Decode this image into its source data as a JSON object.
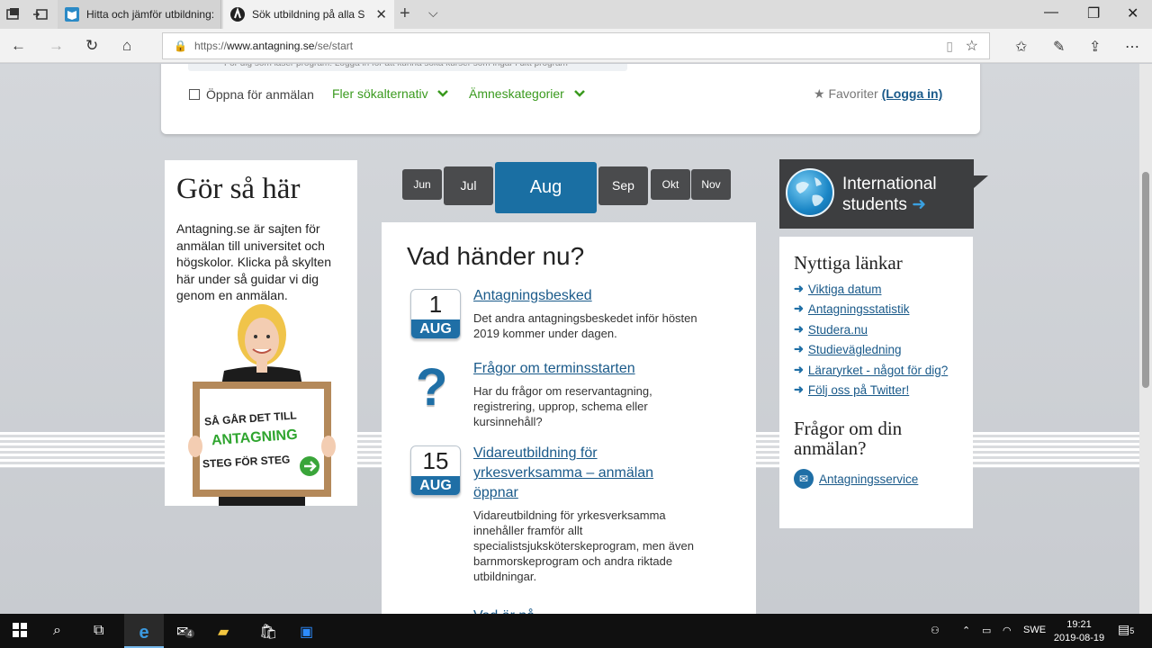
{
  "browser": {
    "tabs": [
      {
        "title": "Hitta och jämför utbildning:",
        "active": false
      },
      {
        "title": "Sök utbildning på alla S",
        "active": true
      }
    ],
    "url_prefix": "https://",
    "url_host": "www.antagning.se",
    "url_path": "/se/start"
  },
  "search": {
    "ghost_text": "För dig som läser program: Logga in för att kunna söka kurser som ingår i ditt program",
    "open_checkbox_label": "Öppna för anmälan",
    "more_options_label": "Fler sökalternativ",
    "subject_categories_label": "Ämneskategorier",
    "favorites_label": "Favoriter",
    "login_label": "(Logga in)"
  },
  "howto": {
    "title": "Gör så här",
    "text": "Antagning.se är sajten för anmälan till universitet och högskolor. Klicka på skylten här under så guidar vi dig genom en anmälan.",
    "sign_line1": "SÅ GÅR DET TILL",
    "sign_line2": "ANTAGNING",
    "sign_line3": "STEG FÖR STEG"
  },
  "months": [
    "Jun",
    "Jul",
    "Aug",
    "Sep",
    "Okt",
    "Nov"
  ],
  "active_month": "Aug",
  "news": {
    "heading": "Vad händer nu?",
    "items": [
      {
        "day": "1",
        "month": "AUG",
        "title": "Antagningsbesked",
        "text": "Det andra antagningsbeskedet inför hösten 2019 kommer under dagen."
      },
      {
        "title": "Frågor om terminsstarten",
        "text": "Har du frågor om reservantagning, registrering, upprop, schema eller kursinnehåll?"
      },
      {
        "day": "15",
        "month": "AUG",
        "title": "Vidareutbildning för yrkesverksamma – anmälan öppnar",
        "text": "Vidareutbildning för yrkesverksamma innehåller framför allt specialistsjuksköterskeprogram, men även barnmorskeprogram och andra riktade utbildningar."
      }
    ],
    "cut_link": "Vad är nå..."
  },
  "international": {
    "line1": "International",
    "line2": "students"
  },
  "useful_links": {
    "heading": "Nyttiga länkar",
    "links": [
      "Viktiga datum",
      "Antagningsstatistik",
      "Studera.nu",
      "Studievägledning",
      "Läraryrket - något för dig?",
      "Följ oss på Twitter!"
    ]
  },
  "questions": {
    "heading": "Frågor om din anmälan?",
    "link": "Antagningsservice"
  },
  "taskbar": {
    "mail_badge": "4",
    "lang": "SWE",
    "time": "19:21",
    "date": "2019-08-19",
    "notif_count": "5"
  },
  "colors": {
    "accent_blue": "#1a6fa3",
    "link_green": "#3a9a1e",
    "dark_panel": "#3d3e40"
  }
}
